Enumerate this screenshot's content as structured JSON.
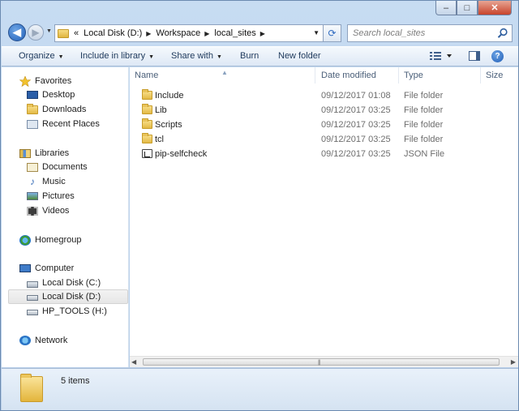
{
  "window": {
    "title": "local_sites"
  },
  "caption": {
    "minimize": "–",
    "maximize": "□",
    "close": "✕"
  },
  "address": {
    "overflow": "«",
    "segments": [
      "Local Disk (D:)",
      "Workspace",
      "local_sites"
    ]
  },
  "search": {
    "placeholder": "Search local_sites"
  },
  "toolbar": {
    "organize": "Organize",
    "include_in_library": "Include in library",
    "share_with": "Share with",
    "burn": "Burn",
    "new_folder": "New folder"
  },
  "sidebar": {
    "favorites": {
      "label": "Favorites",
      "items": [
        "Desktop",
        "Downloads",
        "Recent Places"
      ]
    },
    "libraries": {
      "label": "Libraries",
      "items": [
        "Documents",
        "Music",
        "Pictures",
        "Videos"
      ]
    },
    "homegroup": {
      "label": "Homegroup"
    },
    "computer": {
      "label": "Computer",
      "items": [
        "Local Disk (C:)",
        "Local Disk (D:)",
        "HP_TOOLS (H:)"
      ],
      "selected": "Local Disk (D:)"
    },
    "network": {
      "label": "Network"
    }
  },
  "columns": {
    "name": "Name",
    "date_modified": "Date modified",
    "type": "Type",
    "size": "Size"
  },
  "files": [
    {
      "name": "Include",
      "date": "09/12/2017 01:08",
      "type": "File folder",
      "icon": "folder-icon"
    },
    {
      "name": "Lib",
      "date": "09/12/2017 03:25",
      "type": "File folder",
      "icon": "folder-icon"
    },
    {
      "name": "Scripts",
      "date": "09/12/2017 03:25",
      "type": "File folder",
      "icon": "folder-icon"
    },
    {
      "name": "tcl",
      "date": "09/12/2017 03:25",
      "type": "File folder",
      "icon": "folder-icon"
    },
    {
      "name": "pip-selfcheck",
      "date": "09/12/2017 03:25",
      "type": "JSON File",
      "icon": "json-file-icon"
    }
  ],
  "status": {
    "item_count": "5 items"
  }
}
